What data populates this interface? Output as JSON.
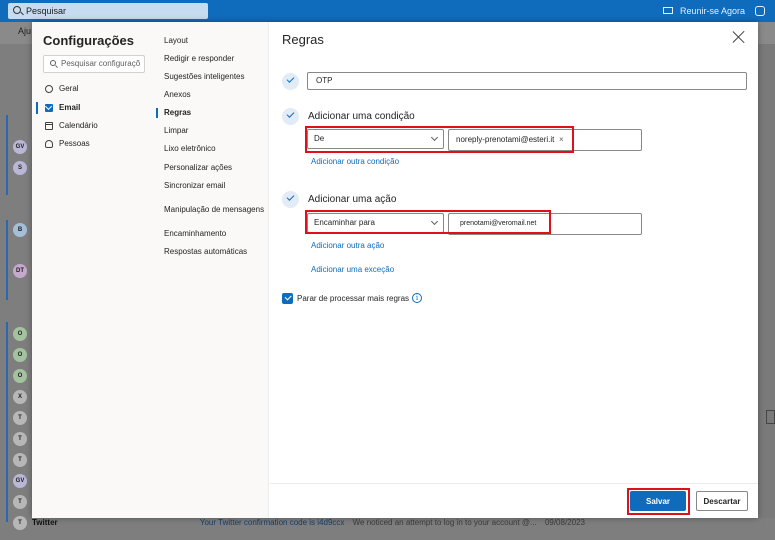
{
  "topbar": {
    "search_text": "Pesquisar",
    "meet_label": "Reunir-se Agora"
  },
  "background": {
    "ribbon_label": "Aju",
    "avatars": [
      "GV",
      "S",
      "B",
      "DT",
      "O",
      "O",
      "O",
      "X",
      "T",
      "T",
      "T",
      "GV",
      "T",
      "T"
    ],
    "avatar_colors": {
      "GV": "#b9b6d6",
      "S": "#b9b6d6",
      "B": "#a6bfd8",
      "DT": "#c6a8cf",
      "O": "#a4c2a0",
      "X": "#b7b7b7",
      "T": "#b7b7b7"
    },
    "bottom_row": {
      "sender": "Twitter",
      "subject": "Your Twitter confirmation code is i4d9ccx",
      "preview": "We noticed an attempt to log in to your account @...",
      "date": "09/08/2023"
    }
  },
  "settings": {
    "title": "Configurações",
    "search_placeholder": "Pesquisar configuraçõ",
    "categories": [
      {
        "label": "Geral",
        "icon": "gear-icon"
      },
      {
        "label": "Email",
        "icon": "mail-icon",
        "active": true
      },
      {
        "label": "Calendário",
        "icon": "calendar-icon"
      },
      {
        "label": "Pessoas",
        "icon": "people-icon"
      }
    ],
    "subcategories": [
      "Layout",
      "Redigir e responder",
      "Sugestões inteligentes",
      "Anexos",
      "Regras",
      "Limpar",
      "Lixo eletrônico",
      "Personalizar ações",
      "Sincronizar email",
      "Manipulação de mensagens",
      "Encaminhamento",
      "Respostas automáticas"
    ],
    "active_subcategory": "Regras"
  },
  "rules": {
    "title": "Regras",
    "rule_name": "OTP",
    "condition_heading": "Adicionar uma condição",
    "condition_type": "De",
    "condition_value": "noreply-prenotami@esteri.it",
    "add_condition_link": "Adicionar outra condição",
    "action_heading": "Adicionar uma ação",
    "action_type": "Encaminhar para",
    "action_value": "prenotami@veromail.net",
    "add_action_link": "Adicionar outra ação",
    "add_exception_link": "Adicionar uma exceção",
    "stop_processing_label": "Parar de processar mais regras",
    "stop_processing_checked": true,
    "save_label": "Salvar",
    "discard_label": "Descartar"
  },
  "colors": {
    "accent": "#0f6cbd",
    "highlight": "#e0101a"
  }
}
